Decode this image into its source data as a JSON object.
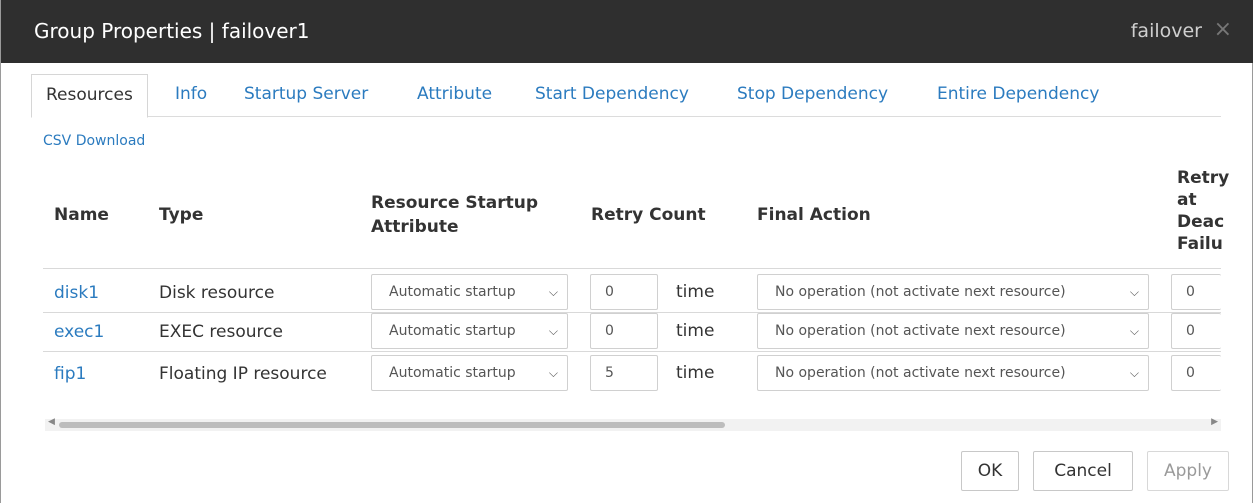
{
  "window": {
    "title": "Group Properties | failover1",
    "subtitle": "failover",
    "close_icon": "×"
  },
  "tabs": [
    "Resources",
    "Info",
    "Startup Server",
    "Attribute",
    "Start Dependency",
    "Stop Dependency",
    "Entire Dependency"
  ],
  "active_tab": "Resources",
  "csv_link": "CSV Download",
  "table": {
    "headers": {
      "name": "Name",
      "type": "Type",
      "startup_line1": "Resource Startup",
      "startup_line2": "Attribute",
      "retry_count": "Retry Count",
      "final_action": "Final Action",
      "retry_deact_1": "Retry",
      "retry_deact_2": "at",
      "retry_deact_3": "Deac",
      "retry_deact_4": "Failu"
    },
    "rows": [
      {
        "name": "disk1",
        "type": "Disk resource",
        "startup": "Automatic startup",
        "retry": "0",
        "unit": "time",
        "final_action": "No operation (not activate next resource)",
        "retry_deact": "0"
      },
      {
        "name": "exec1",
        "type": "EXEC resource",
        "startup": "Automatic startup",
        "retry": "0",
        "unit": "time",
        "final_action": "No operation (not activate next resource)",
        "retry_deact": "0"
      },
      {
        "name": "fip1",
        "type": "Floating IP resource",
        "startup": "Automatic startup",
        "retry": "5",
        "unit": "time",
        "final_action": "No operation (not activate next resource)",
        "retry_deact": "0"
      }
    ]
  },
  "scrollbar": {
    "position_fraction": 0.0,
    "visible_fraction": 0.58
  },
  "buttons": {
    "ok": "OK",
    "cancel": "Cancel",
    "apply": "Apply"
  },
  "icons": {
    "dropdown": "chevron-down-icon",
    "close": "close-icon"
  }
}
